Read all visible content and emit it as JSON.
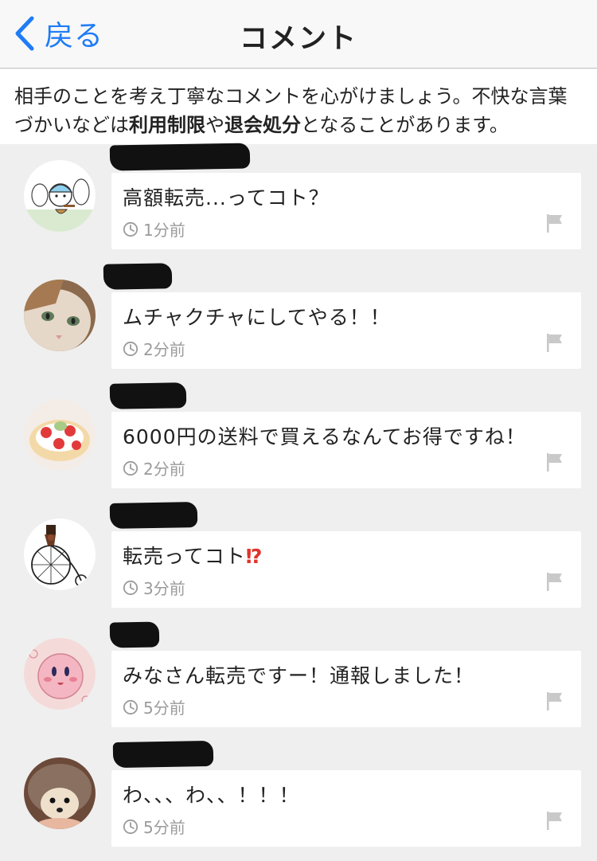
{
  "navbar": {
    "back_label": "戻る",
    "title": "コメント"
  },
  "notice": {
    "text_before": "相手のことを考え丁寧なコメントを心がけましょう。不快な言葉づかいなどは",
    "bold_1": "利用制限",
    "text_mid": "や",
    "bold_2": "退会処分",
    "text_after": "となることがあります。"
  },
  "icons": {
    "back": "chevron-left-icon",
    "time": "clock-icon",
    "report": "flag-icon"
  },
  "colors": {
    "accent": "#1f7cf6",
    "background": "#efefef",
    "meta": "#9b9b9b"
  },
  "comments": [
    {
      "text": "高額転売...ってコト？",
      "time": "1分前",
      "avatar": "cartoon-character"
    },
    {
      "text": "ムチャクチャにしてやる！！",
      "time": "2分前",
      "avatar": "cat-photo"
    },
    {
      "text": "6000円の送料で買えるなんてお得ですね！",
      "time": "2分前",
      "avatar": "strawberry-cake-photo"
    },
    {
      "text": "転売ってコト",
      "emoji": "⁉",
      "time": "3分前",
      "avatar": "penny-farthing-illustration"
    },
    {
      "text": "みなさん転売ですー！通報しました！",
      "time": "5分前",
      "avatar": "kirby-illustration"
    },
    {
      "text": "わ、、、わ、、！！！",
      "time": "5分前",
      "avatar": "hedgehog-photo"
    }
  ]
}
